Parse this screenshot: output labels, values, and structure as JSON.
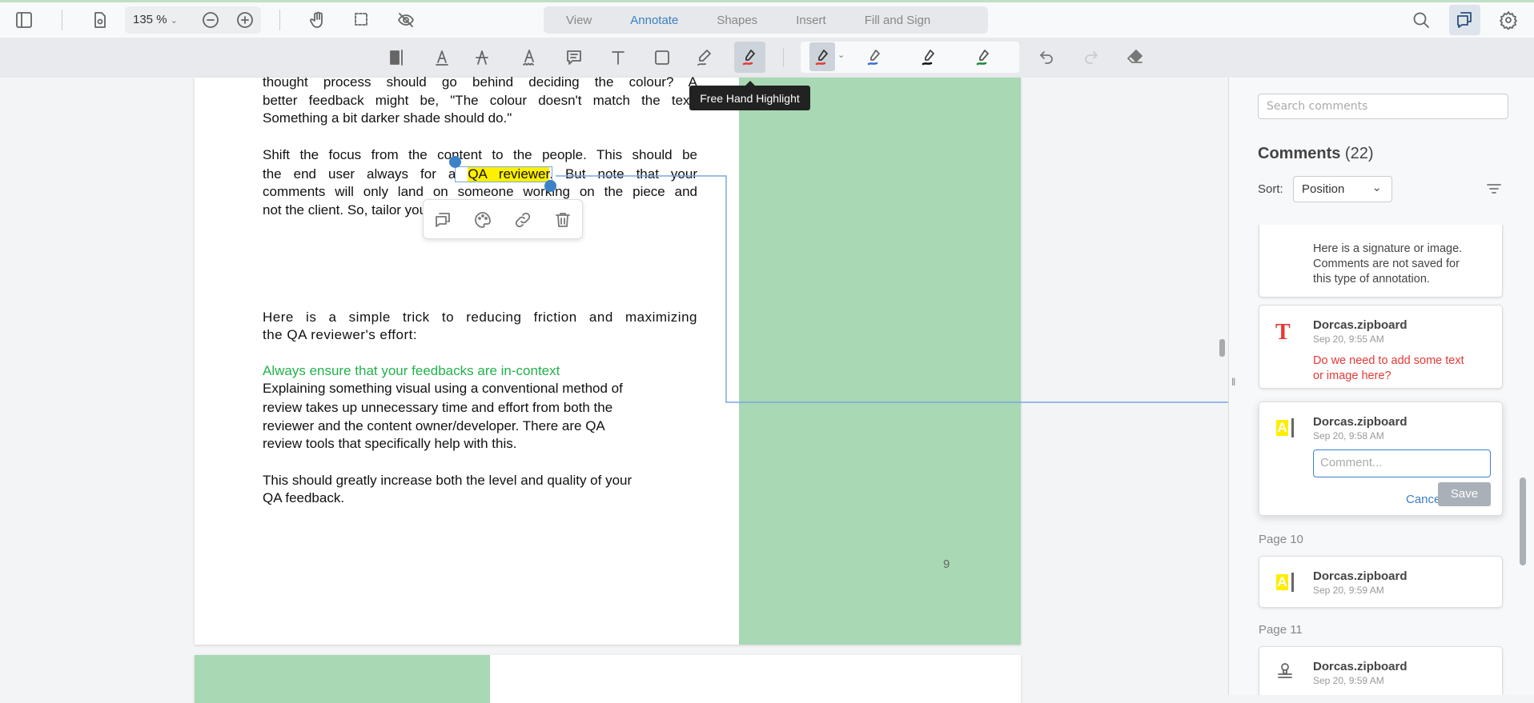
{
  "header": {
    "zoom": "135 %",
    "tabs": [
      "View",
      "Annotate",
      "Shapes",
      "Insert",
      "Fill and Sign"
    ],
    "active_tab": "Annotate"
  },
  "toolbar": {
    "tooltip": "Free Hand Highlight",
    "colors": {
      "active": "#e53935",
      "blue": "#3b6fd8",
      "black": "#111111",
      "green": "#1a8a3a"
    }
  },
  "document": {
    "p1": [
      "thought process should go behind deciding the colour? A",
      "better feedback might be, \"The colour doesn't match the text.",
      "Something a bit darker shade should do.\""
    ],
    "p2": {
      "l1": "Shift the focus from the content to the people. This should be",
      "l2a": "the end user always for a ",
      "l2hl": "QA reviewer",
      "l2b": ". But note that your",
      "l3": "comments will only land on someone working on the piece and",
      "l4": "not the client. So, tailor your comments accordingly."
    },
    "p3": [
      "Here is a simple trick to reducing friction and maximizing",
      "the QA reviewer's effort:"
    ],
    "heading": "Always ensure that your feedbacks are in-context",
    "p4": [
      "Explaining something visual using a conventional method of",
      "review takes up unnecessary time and effort from both the",
      "reviewer and the content owner/developer. There are QA",
      "review tools that specifically help with this."
    ],
    "p5": [
      "This should greatly increase both the level and quality of your",
      "QA feedback."
    ],
    "page_number": "9"
  },
  "panel": {
    "search_placeholder": "Search comments",
    "title": "Comments",
    "count": "(22)",
    "sort_label": "Sort:",
    "sort_value": "Position",
    "cards": [
      {
        "text": [
          "Here is a signature or image.",
          "Comments are not saved for",
          "this type of annotation."
        ]
      },
      {
        "author": "Dorcas.zipboard",
        "date": "Sep 20, 9:55 AM",
        "text": [
          "Do we need to add some text",
          "or image here?"
        ]
      },
      {
        "author": "Dorcas.zipboard",
        "date": "Sep 20, 9:58 AM",
        "placeholder": "Comment...",
        "cancel": "Cancel",
        "save": "Save"
      },
      {
        "page": "Page 10",
        "author": "Dorcas.zipboard",
        "date": "Sep 20, 9:59 AM"
      },
      {
        "page": "Page 11",
        "author": "Dorcas.zipboard",
        "date": "Sep 20, 9:59 AM"
      }
    ]
  }
}
